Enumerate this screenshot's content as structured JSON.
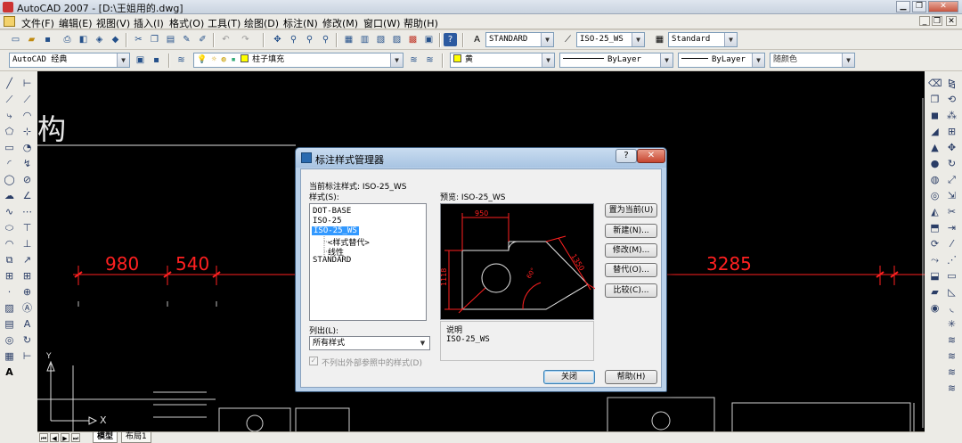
{
  "window": {
    "title": "AutoCAD 2007 - [D:\\王姐用的.dwg]",
    "minimize": "▁",
    "restore": "❐",
    "close": "✕",
    "mdi_minimize": "_",
    "mdi_restore": "❐",
    "mdi_close": "✕"
  },
  "menu": [
    "文件(F)",
    "编辑(E)",
    "视图(V)",
    "插入(I)",
    "格式(O)",
    "工具(T)",
    "绘图(D)",
    "标注(N)",
    "修改(M)",
    "窗口(W)",
    "帮助(H)"
  ],
  "toolbar": {
    "text_style": "STANDARD",
    "dim_style": "ISO-25_WS",
    "table_style": "Standard",
    "workspace": "AutoCAD 经典",
    "layer": "柱子填充",
    "color": "黄",
    "linetype": "ByLayer",
    "lineweight": "ByLayer",
    "plot_style": "随颜色",
    "colors": {
      "layer_yellow": "#ffff00"
    }
  },
  "canvas": {
    "heading_text": "构",
    "dim_labels": [
      "980",
      "540",
      "3285"
    ],
    "colors": {
      "background": "#000000",
      "dimension": "#ff2020",
      "geometry": "#e0e0e0"
    }
  },
  "layout_tabs": {
    "model": "模型",
    "layout1": "布局1"
  },
  "dialog": {
    "title": "标注样式管理器",
    "current_style_label": "当前标注样式:",
    "current_style_value": "ISO-25_WS",
    "styles_label": "样式(S):",
    "styles": [
      {
        "name": "DOT-BASE",
        "selected": false,
        "indent": 0
      },
      {
        "name": "ISO-25",
        "selected": false,
        "indent": 0
      },
      {
        "name": "ISO-25_WS",
        "selected": true,
        "indent": 0
      },
      {
        "name": "<样式替代>",
        "selected": false,
        "indent": 1
      },
      {
        "name": "线性",
        "selected": false,
        "indent": 1
      },
      {
        "name": "STANDARD",
        "selected": false,
        "indent": 0
      }
    ],
    "preview_label": "预览:",
    "preview_value": "ISO-25_WS",
    "preview_dims": [
      "950",
      "1118",
      "1350",
      "60°"
    ],
    "list_label": "列出(L):",
    "list_value": "所有样式",
    "checkbox_label": "不列出外部参照中的样式(D)",
    "checkbox_checked": true,
    "description_label": "说明",
    "description_value": "ISO-25_WS",
    "buttons": {
      "set_current": "置为当前(U)",
      "new": "新建(N)...",
      "modify": "修改(M)...",
      "override": "替代(O)...",
      "compare": "比较(C)...",
      "close": "关闭",
      "help": "帮助(H)"
    },
    "help_glyph": "?",
    "close_glyph": "✕"
  }
}
